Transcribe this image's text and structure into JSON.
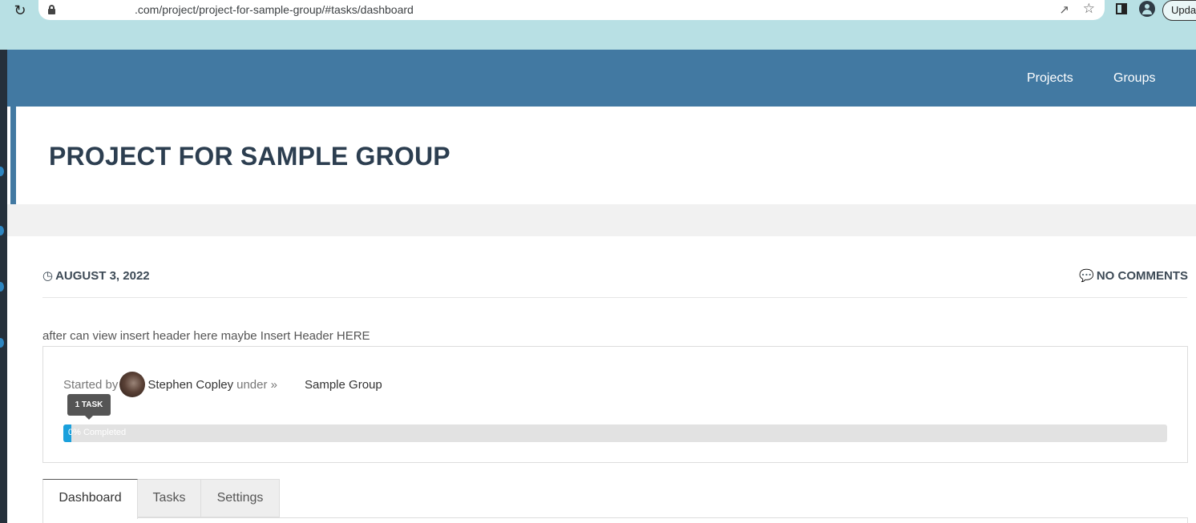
{
  "browser": {
    "url": ".com/project/project-for-sample-group/#tasks/dashboard",
    "update_label": "Updat"
  },
  "nav": {
    "items": [
      {
        "label": "Projects"
      },
      {
        "label": "Groups"
      }
    ]
  },
  "project": {
    "title": "PROJECT FOR SAMPLE GROUP",
    "date": "AUGUST 3, 2022",
    "comments": "NO COMMENTS",
    "intro": "after can view insert header here maybe Insert Header HERE",
    "started_by_label": "Started by",
    "author": "Stephen Copley",
    "under_label": "under »",
    "group": "Sample Group",
    "task_count_label": "1 TASK",
    "progress_text": "0% Completed",
    "progress_percent": 0
  },
  "tabs": [
    {
      "label": "Dashboard",
      "active": true
    },
    {
      "label": "Tasks",
      "active": false
    },
    {
      "label": "Settings",
      "active": false
    }
  ],
  "colors": {
    "nav_bg": "#4279a2",
    "title": "#2c3e50",
    "progress": "#1aa0dc"
  },
  "icons": {
    "date": "clock-icon",
    "comments": "comments-icon"
  }
}
